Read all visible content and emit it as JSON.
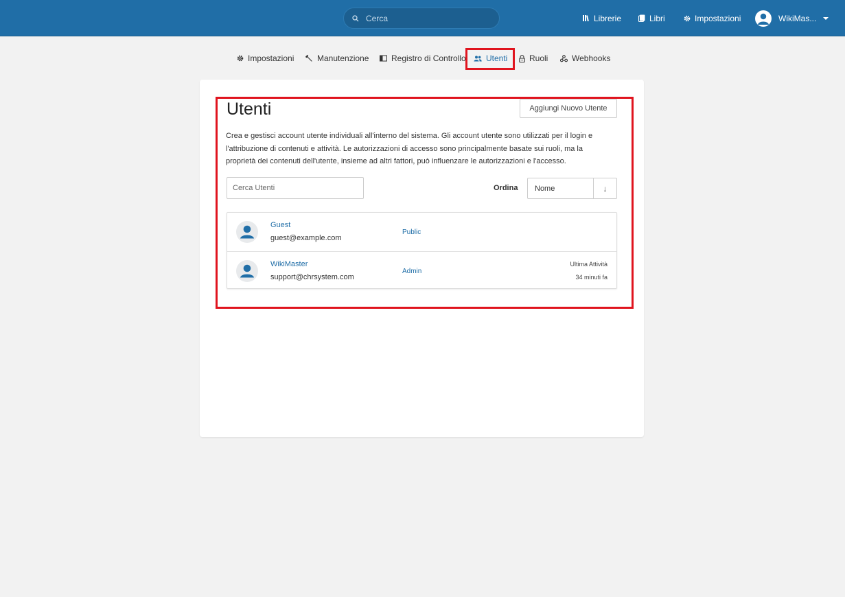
{
  "header": {
    "search_placeholder": "Cerca",
    "nav": [
      {
        "label": "Librerie",
        "icon": "shelves-icon"
      },
      {
        "label": "Libri",
        "icon": "books-icon"
      },
      {
        "label": "Impostazioni",
        "icon": "gear-icon"
      }
    ],
    "user_name": "WikiMas...",
    "brand_color": "#206ea7"
  },
  "tabs": [
    {
      "label": "Impostazioni",
      "icon": "gear-icon"
    },
    {
      "label": "Manutenzione",
      "icon": "wrench-icon"
    },
    {
      "label": "Registro di Controllo",
      "icon": "audit-icon"
    },
    {
      "label": "Utenti",
      "icon": "users-icon",
      "active": true
    },
    {
      "label": "Ruoli",
      "icon": "lock-icon"
    },
    {
      "label": "Webhooks",
      "icon": "webhook-icon"
    }
  ],
  "main": {
    "title": "Utenti",
    "add_button": "Aggiungi Nuovo Utente",
    "description": "Crea e gestisci account utente individuali all'interno del sistema. Gli account utente sono utilizzati per il login e l'attribuzione di contenuti e attività. Le autorizzazioni di accesso sono principalmente basate sui ruoli, ma la proprietà dei contenuti dell'utente, insieme ad altri fattori, può influenzare le autorizzazioni e l'accesso.",
    "search_placeholder": "Cerca Utenti",
    "sort_label": "Ordina",
    "sort_value": "Nome",
    "sort_direction": "↓"
  },
  "users": [
    {
      "name": "Guest",
      "email": "guest@example.com",
      "role": "Public",
      "activity_label": "",
      "activity_value": ""
    },
    {
      "name": "WikiMaster",
      "email": "support@chrsystem.com",
      "role": "Admin",
      "activity_label": "Ultima Attività",
      "activity_value": "34 minuti fa"
    }
  ]
}
